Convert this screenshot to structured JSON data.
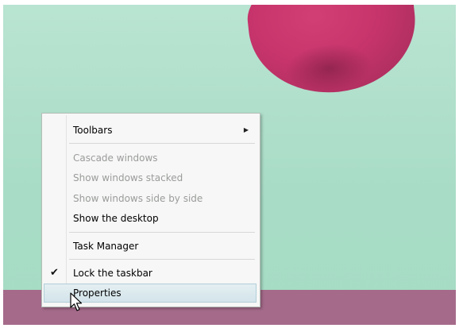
{
  "context_menu": {
    "items": [
      {
        "label": "Toolbars",
        "submenu": true,
        "enabled": true
      },
      {
        "label": "Cascade windows",
        "enabled": false
      },
      {
        "label": "Show windows stacked",
        "enabled": false
      },
      {
        "label": "Show windows side by side",
        "enabled": false
      },
      {
        "label": "Show the desktop",
        "enabled": true
      },
      {
        "label": "Task Manager",
        "enabled": true
      },
      {
        "label": "Lock the taskbar",
        "enabled": true,
        "checked": true
      },
      {
        "label": "Properties",
        "enabled": true,
        "hovered": true
      }
    ],
    "submenu_arrow_icon": "triangle-right-icon",
    "check_icon": "checkmark-icon"
  },
  "colors": {
    "desktop_background": "#b9e4d2",
    "taskbar": "#a56a8a",
    "wallpaper_accent": "#c72b66"
  }
}
